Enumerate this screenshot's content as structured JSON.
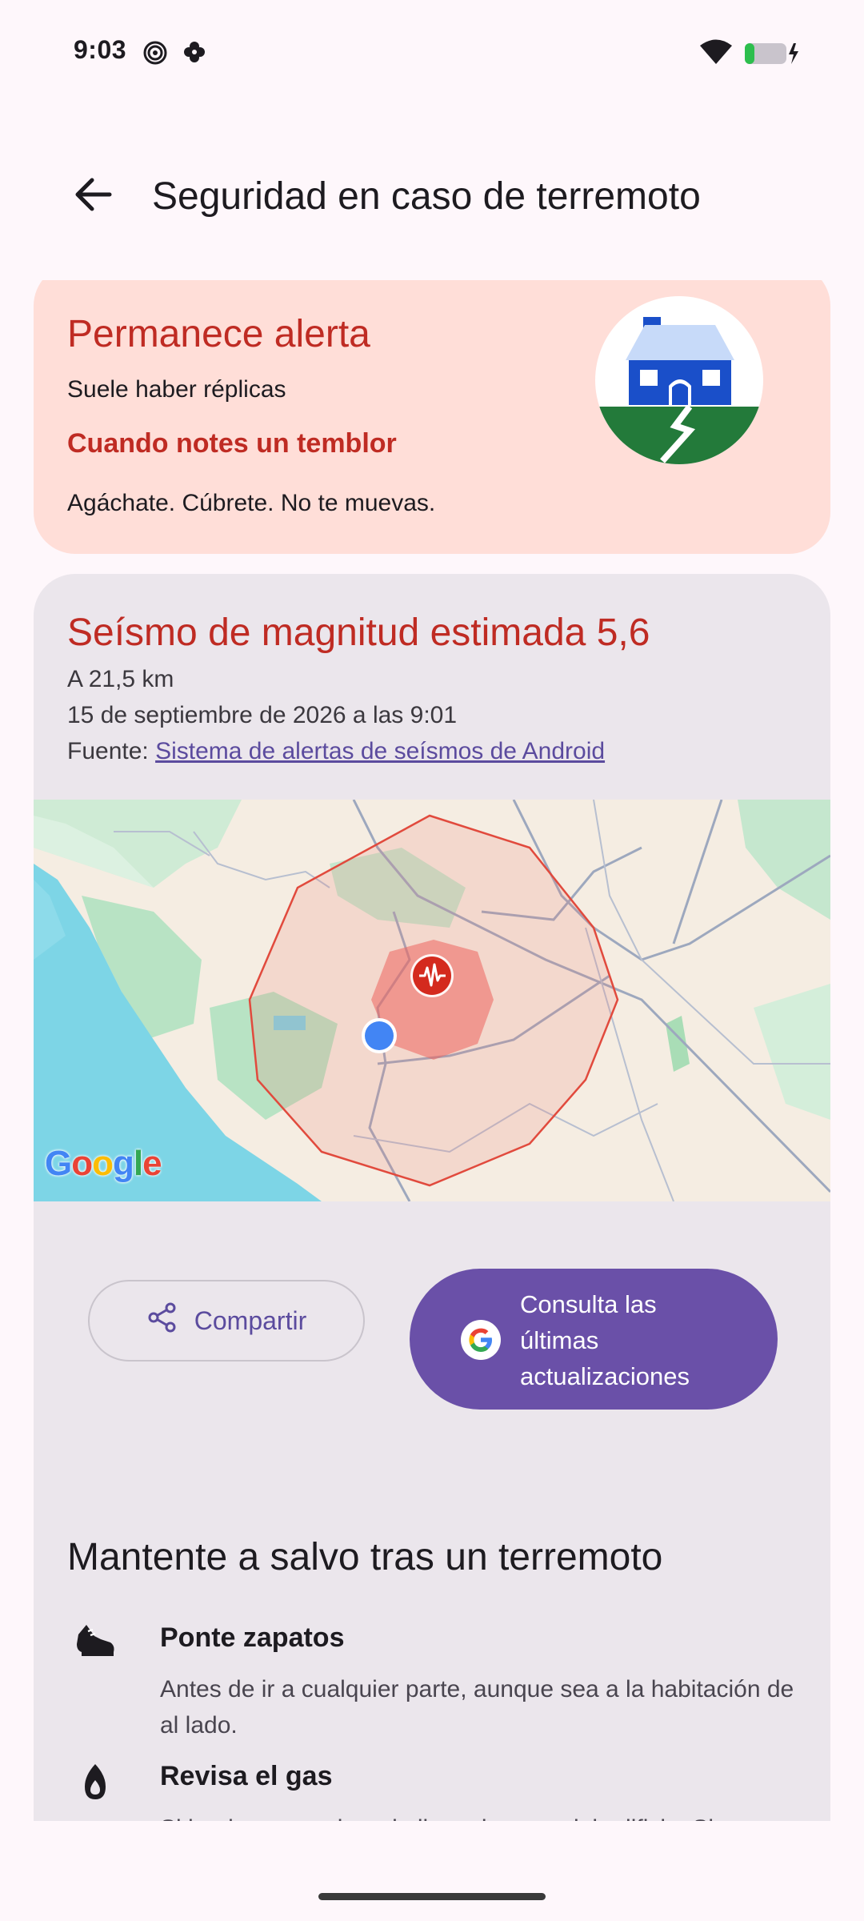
{
  "status_bar": {
    "time": "9:03",
    "icons_left": [
      "hotspot-icon",
      "pinwheel-icon"
    ],
    "icons_right": [
      "wifi-icon",
      "battery-charging-icon"
    ]
  },
  "app_bar": {
    "back_icon": "arrow-back-icon",
    "title": "Seguridad en caso de terremoto"
  },
  "alert_card": {
    "title": "Permanece alerta",
    "subtitle": "Suele haber réplicas",
    "heading": "Cuando notes un temblor",
    "instruction": "Agáchate. Cúbrete. No te muevas.",
    "illustration": "house-earthquake-illustration"
  },
  "quake_card": {
    "title": "Seísmo de magnitud estimada 5,6",
    "distance": "A 21,5 km",
    "datetime": "15 de septiembre de 2026 a las 9:01",
    "source_label": "Fuente:",
    "source_link": "Sistema de alertas de seísmos de Android",
    "map_logo": "Google",
    "share_label": "Compartir",
    "updates_label_lines": [
      "Consulta las",
      "últimas",
      "actualizaciones"
    ]
  },
  "safety_card": {
    "title": "Mantente a salvo tras un terremoto",
    "tips": [
      {
        "icon": "shoe-icon",
        "title": "Ponte zapatos",
        "body": "Antes de ir a cualquier parte, aunque sea a la habitación de al lado."
      },
      {
        "icon": "flame-icon",
        "title": "Revisa el gas",
        "body": "Si huele a gas, cierra la llave de paso del edificio. Si no"
      }
    ]
  },
  "colors": {
    "alert_red": "#BF2B23",
    "alert_bg": "#FFDED8",
    "card_bg": "#EBE6EC",
    "primary": "#6A50A8",
    "link": "#5B4B9E"
  }
}
